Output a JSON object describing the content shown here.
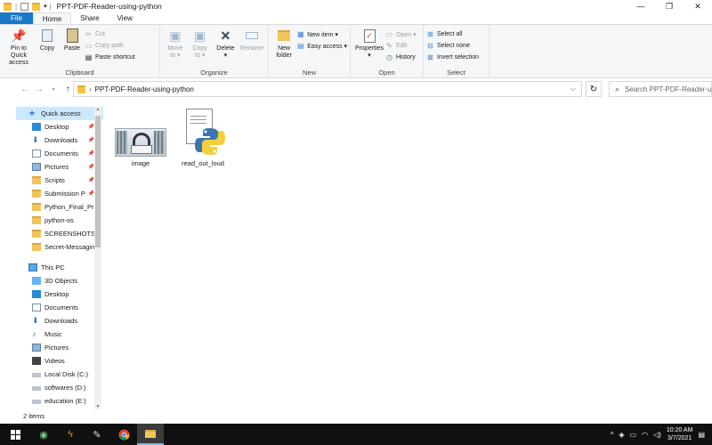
{
  "window": {
    "title": "PPT-PDF-Reader-using-python",
    "minimize": "—",
    "maximize": "❐",
    "close": "✕"
  },
  "tabs": [
    "File",
    "Home",
    "Share",
    "View"
  ],
  "ribbon": {
    "clipboard": {
      "label": "Clipboard",
      "pin_line1": "Pin to Quick",
      "pin_line2": "access",
      "copy": "Copy",
      "paste": "Paste",
      "cut": "Cut",
      "copy_path": "Copy path",
      "paste_shortcut": "Paste shortcut"
    },
    "organize": {
      "label": "Organize",
      "move_to": "Move",
      "move_to2": "to ▾",
      "copy_to": "Copy",
      "copy_to2": "to ▾",
      "delete": "Delete",
      "delete2": "▾",
      "rename": "Rename"
    },
    "new": {
      "label": "New",
      "new_folder1": "New",
      "new_folder2": "folder",
      "new_item": "New item ▾",
      "easy_access": "Easy access ▾"
    },
    "open": {
      "label": "Open",
      "properties": "Properties",
      "properties2": "▾",
      "open": "Open ▾",
      "edit": "Edit",
      "history": "History"
    },
    "select": {
      "label": "Select",
      "select_all": "Select all",
      "select_none": "Select none",
      "invert": "Invert selection"
    }
  },
  "address": {
    "path": "PPT-PDF-Reader-using-python",
    "search_placeholder": "Search PPT-PDF-Reader-using-python"
  },
  "nav": {
    "quick_access": "Quick access",
    "quick_items": [
      {
        "label": "Desktop",
        "pinned": "📌"
      },
      {
        "label": "Downloads",
        "pinned": "📌"
      },
      {
        "label": "Documents",
        "pinned": "📌"
      },
      {
        "label": "Pictures",
        "pinned": "📌"
      },
      {
        "label": "Scripts",
        "pinned": "📌"
      },
      {
        "label": "Submission P",
        "pinned": "📌"
      },
      {
        "label": "Python_Final_Pr",
        "pinned": ""
      },
      {
        "label": "python-os",
        "pinned": ""
      },
      {
        "label": "SCREENSHOTS",
        "pinned": ""
      },
      {
        "label": "Secret-Messagin",
        "pinned": ""
      }
    ],
    "this_pc": "This PC",
    "pc_items": [
      "3D Objects",
      "Desktop",
      "Documents",
      "Downloads",
      "Music",
      "Pictures",
      "Videos",
      "Local Disk (C:)",
      "softwares (D:)",
      "education (E:)"
    ]
  },
  "files": [
    {
      "name": "image",
      "icon": "image-thumbnail"
    },
    {
      "name": "read_out_loud",
      "icon": "python-file-icon"
    }
  ],
  "status": {
    "count": "2 items"
  },
  "taskbar": {
    "time": "10:20 AM",
    "date": "3/7/2021",
    "tray_chevron": "^"
  }
}
